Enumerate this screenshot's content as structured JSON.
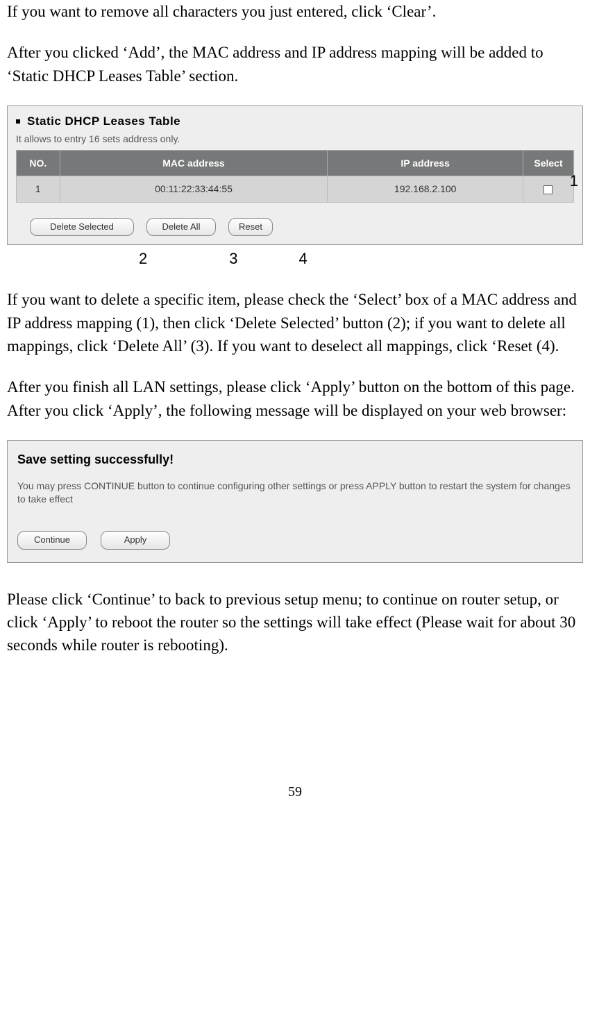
{
  "paragraphs": {
    "p1": "If you want to remove all characters you just entered, click ‘Clear’.",
    "p2": "After you clicked ‘Add’, the MAC address and IP address mapping will be added to ‘Static DHCP Leases Table’ section.",
    "p3": "If you want to delete a specific item, please check the ‘Select’ box of a MAC address and IP address mapping (1), then click ‘Delete Selected’ button (2); if you want to delete all mappings, click ‘Delete All’ (3). If you want to deselect all mappings, click ‘Reset (4).",
    "p4": "After you finish all LAN settings, please click ‘Apply’ button on the bottom of this page. After you click ‘Apply’, the following message will be displayed on your web browser:",
    "p5": "Please click ‘Continue’ to back to previous setup menu; to continue on router setup, or click ‘Apply’ to reboot the router so the settings will take effect (Please wait for about 30 seconds while router is rebooting)."
  },
  "dhcp_panel": {
    "title": "Static DHCP Leases Table",
    "subtitle": "It allows to entry 16 sets address only.",
    "headers": {
      "no": "NO.",
      "mac": "MAC address",
      "ip": "IP address",
      "select": "Select"
    },
    "row": {
      "no": "1",
      "mac": "00:11:22:33:44:55",
      "ip": "192.168.2.100"
    },
    "buttons": {
      "delete_selected": "Delete Selected",
      "delete_all": "Delete All",
      "reset": "Reset"
    }
  },
  "callouts": {
    "c1": "1",
    "c2": "2",
    "c3": "3",
    "c4": "4"
  },
  "save_panel": {
    "title": "Save setting successfully!",
    "message": "You may press CONTINUE button to continue configuring other settings or press APPLY button to restart the system for changes to take effect",
    "buttons": {
      "continue": "Continue",
      "apply": "Apply"
    }
  },
  "page_number": "59"
}
